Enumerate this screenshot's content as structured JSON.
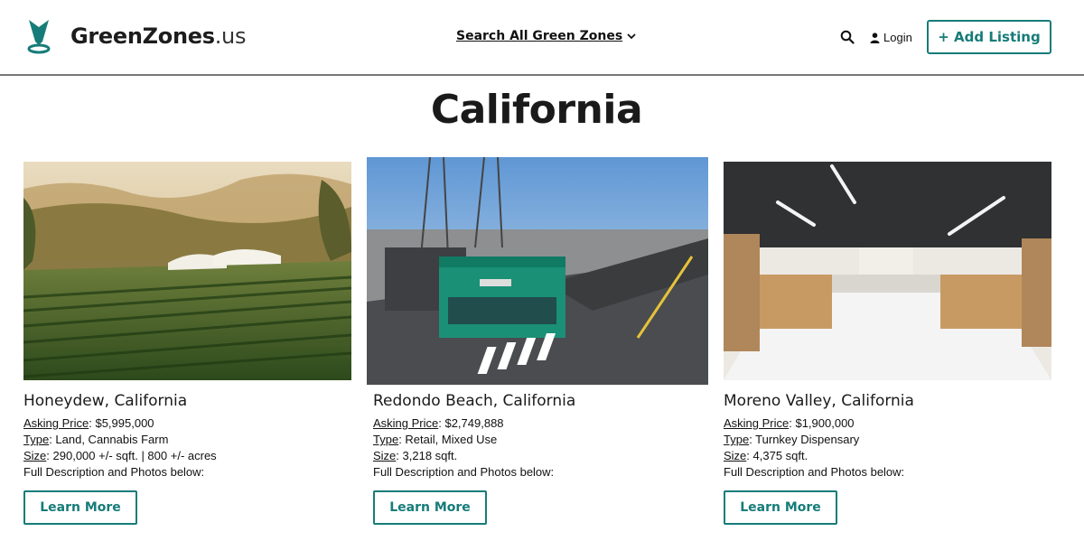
{
  "header": {
    "logo_bold": "GreenZones",
    "logo_light": ".us",
    "search_all_label": "Search All Green Zones",
    "login_label": "Login",
    "add_listing_label": "+ Add Listing"
  },
  "page": {
    "title": "California"
  },
  "colors": {
    "accent": "#167c79",
    "text": "#111111"
  },
  "listings": [
    {
      "name": "Honeydew, California",
      "asking_label": "Asking Price",
      "asking_value": ": $5,995,000",
      "type_label": "Type",
      "type_value": ": Land, Cannabis Farm",
      "size_label": "Size",
      "size_value": ": 290,000 +/- sqft. | 800 +/- acres",
      "description": "Full Description and Photos below:",
      "button": "Learn More",
      "image": "cannabis-farm-photo"
    },
    {
      "name": "Redondo Beach, California",
      "asking_label": "Asking Price",
      "asking_value": ": $2,749,888",
      "type_label": "Type",
      "type_value": ": Retail, Mixed Use",
      "size_label": "Size",
      "size_value": ": 3,218 sqft.",
      "description": "Full Description and Photos below:",
      "button": "Learn More",
      "image": "street-building-photo"
    },
    {
      "name": "Moreno Valley, California",
      "asking_label": "Asking Price",
      "asking_value": ": $1,900,000",
      "type_label": "Type",
      "type_value": ": Turnkey Dispensary",
      "size_label": "Size",
      "size_value": ": 4,375 sqft.",
      "description": "Full Description and Photos below:",
      "button": "Learn More",
      "image": "dispensary-interior-photo"
    }
  ]
}
